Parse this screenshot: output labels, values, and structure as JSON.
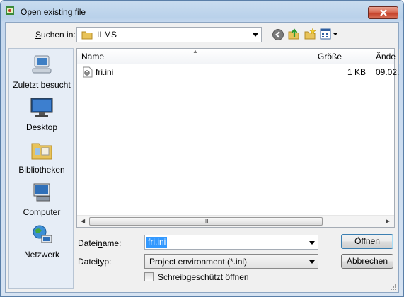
{
  "window": {
    "title": "Open existing file"
  },
  "toolbar": {
    "look_in_label_u": "S",
    "look_in_label_rest": "uchen in:",
    "look_in_value": "ILMS"
  },
  "places": [
    {
      "label": "Zuletzt besucht"
    },
    {
      "label": "Desktop"
    },
    {
      "label": "Bibliotheken"
    },
    {
      "label": "Computer"
    },
    {
      "label": "Netzwerk"
    }
  ],
  "file_list": {
    "columns": [
      "Name",
      "Größe",
      "Ände"
    ],
    "rows": [
      {
        "name": "fri.ini",
        "size": "1 KB",
        "date": "09.02."
      }
    ],
    "scroll_grip": "III"
  },
  "form": {
    "filename_label_a": "Datei",
    "filename_label_u": "n",
    "filename_label_b": "ame:",
    "filename_value": "fri.ini",
    "filetype_label_a": "Datei",
    "filetype_label_u": "t",
    "filetype_label_b": "yp:",
    "filetype_value": "Project environment (*.ini)",
    "readonly_label_u": "S",
    "readonly_label_rest": "chreibgeschützt öffnen",
    "open_button_u": "Ö",
    "open_button_rest": "ffnen",
    "cancel_button": "Abbrechen"
  },
  "colors": {
    "selection": "#3399ff",
    "titlebar_light": "#c9dcef",
    "close_red": "#c4412a"
  }
}
